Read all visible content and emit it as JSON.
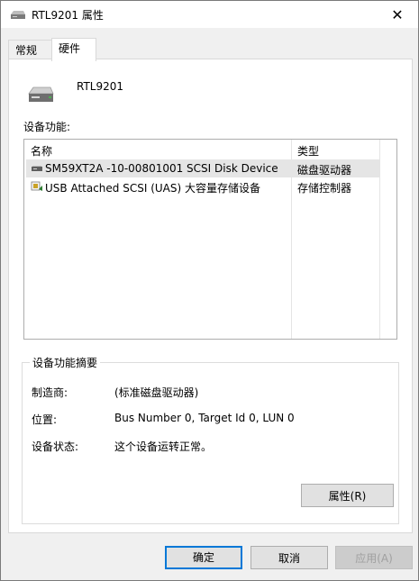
{
  "window": {
    "title": "RTL9201 属性",
    "close_symbol": "✕"
  },
  "tabs": [
    {
      "label": "常规"
    },
    {
      "label": "硬件"
    }
  ],
  "device": {
    "name": "RTL9201"
  },
  "functions": {
    "label": "设备功能:",
    "columns": {
      "name": "名称",
      "type": "类型"
    },
    "rows": [
      {
        "name": "SM59XT2A -10-00801001 SCSI Disk Device",
        "type": "磁盘驱动器",
        "icon": "disk-drive-icon"
      },
      {
        "name": "USB Attached SCSI (UAS) 大容量存储设备",
        "type": "存储控制器",
        "icon": "storage-controller-icon"
      }
    ]
  },
  "summary": {
    "title": "设备功能摘要",
    "manufacturer_label": "制造商:",
    "manufacturer_value": "(标准磁盘驱动器)",
    "location_label": "位置:",
    "location_value": "Bus Number 0, Target Id 0, LUN 0",
    "status_label": "设备状态:",
    "status_value": "这个设备运转正常。",
    "properties_button": "属性(R)"
  },
  "footer": {
    "ok": "确定",
    "cancel": "取消",
    "apply": "应用(A)"
  },
  "colors": {
    "accent": "#0078d7",
    "selected_row": "#e5e5e5"
  }
}
